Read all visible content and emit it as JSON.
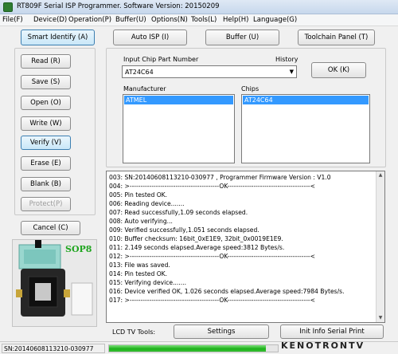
{
  "window": {
    "title": "RT809F Serial ISP Programmer. Software Version: 20150209"
  },
  "menu": [
    "File(F)",
    "Device(D)",
    "Operation(P)",
    "Buffer(U)",
    "Options(N)",
    "Tools(L)",
    "Help(H)",
    "Language(G)"
  ],
  "toolbar": {
    "smart_identify": "Smart Identify (A)",
    "auto_isp": "Auto ISP (I)",
    "buffer": "Buffer (U)",
    "toolchain_panel": "Toolchain Panel (T)"
  },
  "ops": {
    "read": "Read (R)",
    "save": "Save (S)",
    "open": "Open (O)",
    "write": "Write (W)",
    "verify": "Verify (V)",
    "erase": "Erase (E)",
    "blank": "Blank (B)",
    "protect": "Protect(P)",
    "cancel": "Cancel (C)"
  },
  "chip": {
    "input_label": "Input Chip Part Number",
    "history_label": "History",
    "part_value": "AT24C64",
    "ok": "OK (K)",
    "manufacturer_label": "Manufacturer",
    "chips_label": "Chips",
    "manufacturers": [
      "ATMEL"
    ],
    "chips": [
      "AT24C64"
    ]
  },
  "photo": {
    "package_label": "SOP8"
  },
  "log": [
    "003:  SN:20140608113210-030977 , Programmer Firmware Version : V1.0",
    "004:  >-----------------------------------------OK--------------------------------------<",
    "005:  Pin tested OK.",
    "006:  Reading device.......",
    "007:  Read successfully,1.09 seconds elapsed.",
    "008:  Auto verifying...",
    "009:  Verified successfully,1.051 seconds elapsed.",
    "010:  Buffer checksum: 16bit_0xE1E9, 32bit_0x0019E1E9.",
    "011:  2.149 seconds elapsed.Average speed:3812 Bytes/s.",
    "012:  >-----------------------------------------OK--------------------------------------<",
    "013:  File was saved.",
    "014:  Pin tested OK.",
    "015:  Verifying device.......",
    "016:  Device verified OK, 1.026 seconds elapsed.Average speed:7984 Bytes/s.",
    "017:  >-----------------------------------------OK--------------------------------------<"
  ],
  "bottom": {
    "lcd_label": "LCD TV Tools:",
    "settings": "Settings",
    "init_serial": "Init Info Serial Print"
  },
  "status": {
    "sn": "SN:20140608113210-030977",
    "progress_fraction": 0.93
  },
  "watermark": "KENOTRONTV",
  "colors": {
    "selection": "#3399ff",
    "progress": "#1eb01b",
    "package_label": "#1fa51f"
  }
}
